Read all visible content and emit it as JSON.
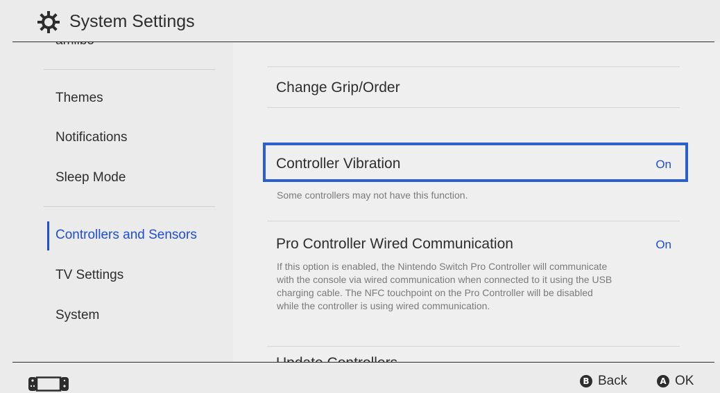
{
  "header": {
    "title": "System Settings",
    "icon": "gear-icon"
  },
  "sidebar": {
    "cut_top_item": "amiibo",
    "items": [
      {
        "label": "Themes",
        "active": false
      },
      {
        "label": "Notifications",
        "active": false
      },
      {
        "label": "Sleep Mode",
        "active": false
      },
      {
        "label": "Controllers and Sensors",
        "active": true
      },
      {
        "label": "TV Settings",
        "active": false
      },
      {
        "label": "System",
        "active": false
      }
    ]
  },
  "main": {
    "change_grip": {
      "label": "Change Grip/Order"
    },
    "vibration": {
      "label": "Controller Vibration",
      "value": "On",
      "description": "Some controllers may not have this function."
    },
    "wired": {
      "label": "Pro Controller Wired Communication",
      "value": "On",
      "description_lines": [
        "If this option is enabled, the Nintendo Switch Pro Controller will communicate",
        "with the console via wired communication when connected to it using the USB",
        "charging cable. The NFC touchpoint on the Pro Controller will be disabled",
        "while the controller is using wired communication."
      ]
    },
    "cut_bottom_item": "Update Controllers"
  },
  "footer": {
    "back": {
      "button": "B",
      "label": "Back"
    },
    "ok": {
      "button": "A",
      "label": "OK"
    }
  },
  "colors": {
    "accent": "#1e4dd6",
    "focus": "#2a5fd0",
    "background": "#ebebeb"
  }
}
